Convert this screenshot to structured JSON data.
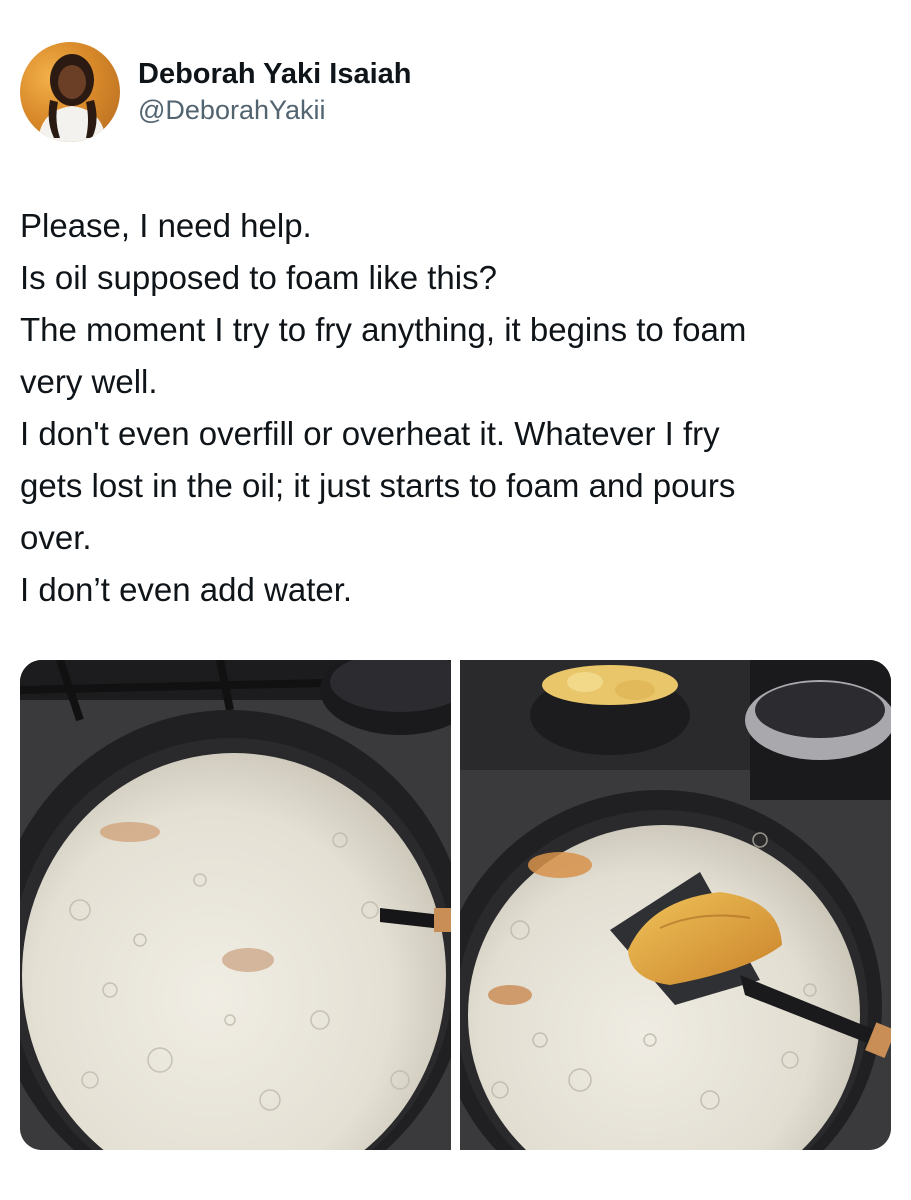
{
  "author": {
    "display_name": "Deborah Yaki Isaiah",
    "handle": "@DeborahYakii"
  },
  "tweet": {
    "lines": [
      "Please, I need help.",
      "Is oil supposed to foam like this?",
      "The moment I try to fry anything, it begins to foam",
      "very well.",
      "I don't even overfill or overheat it. Whatever I fry",
      "gets lost in the oil; it just starts to foam and pours",
      "over.",
      "I don’t even add water."
    ]
  },
  "colors": {
    "text": "#0f1419",
    "secondary": "#536471",
    "foam": "#e9e6dc",
    "pan": "#1f1f22",
    "plantain": "#e0a33a"
  }
}
